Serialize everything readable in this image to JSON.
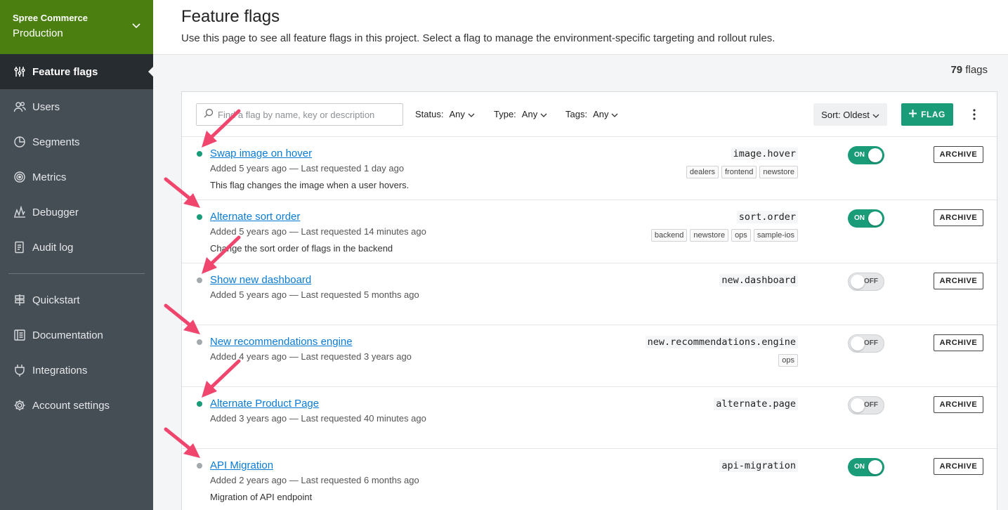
{
  "project": {
    "org": "Spree Commerce",
    "environment": "Production"
  },
  "sidebar": {
    "items": [
      {
        "label": "Feature flags",
        "icon": "sliders-icon",
        "active": true
      },
      {
        "label": "Users",
        "icon": "users-icon"
      },
      {
        "label": "Segments",
        "icon": "pie-chart-icon"
      },
      {
        "label": "Metrics",
        "icon": "target-icon"
      },
      {
        "label": "Debugger",
        "icon": "waveform-icon"
      },
      {
        "label": "Audit log",
        "icon": "document-icon"
      }
    ],
    "secondary": [
      {
        "label": "Quickstart",
        "icon": "signpost-icon"
      },
      {
        "label": "Documentation",
        "icon": "book-icon"
      },
      {
        "label": "Integrations",
        "icon": "plug-icon"
      },
      {
        "label": "Account settings",
        "icon": "gear-icon"
      }
    ]
  },
  "header": {
    "title": "Feature flags",
    "subtitle": "Use this page to see all feature flags in this project. Select a flag to manage the environment-specific targeting and rollout rules."
  },
  "count": {
    "number": "79",
    "unit": "flags"
  },
  "toolbar": {
    "search_placeholder": "Find a flag by name, key or description",
    "status_label": "Status:",
    "status_value": "Any",
    "type_label": "Type:",
    "type_value": "Any",
    "tags_label": "Tags:",
    "tags_value": "Any",
    "sort_label": "Sort: Oldest",
    "add_flag_label": "FLAG"
  },
  "flags": [
    {
      "name": "Swap image on hover",
      "meta": "Added 5 years ago — Last requested 1 day ago",
      "description": "This flag changes the image when a user hovers.",
      "key": "image.hover",
      "tags": [
        "dealers",
        "frontend",
        "newstore"
      ],
      "on": true,
      "status_color": "#1a9c79"
    },
    {
      "name": "Alternate sort order",
      "meta": "Added 5 years ago — Last requested 14 minutes ago",
      "description": "Change the sort order of flags in the backend",
      "key": "sort.order",
      "tags": [
        "backend",
        "newstore",
        "ops",
        "sample-ios"
      ],
      "on": true,
      "status_color": "#1a9c79"
    },
    {
      "name": "Show new dashboard",
      "meta": "Added 5 years ago — Last requested 5 months ago",
      "description": "",
      "key": "new.dashboard",
      "tags": [],
      "on": false,
      "status_color": "#a4a9ad"
    },
    {
      "name": "New recommendations engine",
      "meta": "Added 4 years ago — Last requested 3 years ago",
      "description": "",
      "key": "new.recommendations.engine",
      "tags": [
        "ops"
      ],
      "on": false,
      "status_color": "#a4a9ad"
    },
    {
      "name": "Alternate Product Page",
      "meta": "Added 3 years ago — Last requested 40 minutes ago",
      "description": "",
      "key": "alternate.page",
      "tags": [],
      "on": false,
      "status_color": "#1a9c79"
    },
    {
      "name": "API Migration",
      "meta": "Added 2 years ago — Last requested 6 months ago",
      "description": "Migration of API endpoint",
      "key": "api-migration",
      "tags": [],
      "on": true,
      "status_color": "#a4a9ad"
    }
  ],
  "labels": {
    "on": "ON",
    "off": "OFF",
    "archive": "ARCHIVE"
  },
  "colors": {
    "brand_green": "#4b7f10",
    "accent": "#1a9c79",
    "link": "#0a7bd6",
    "annotation_arrow": "#f0466e"
  }
}
